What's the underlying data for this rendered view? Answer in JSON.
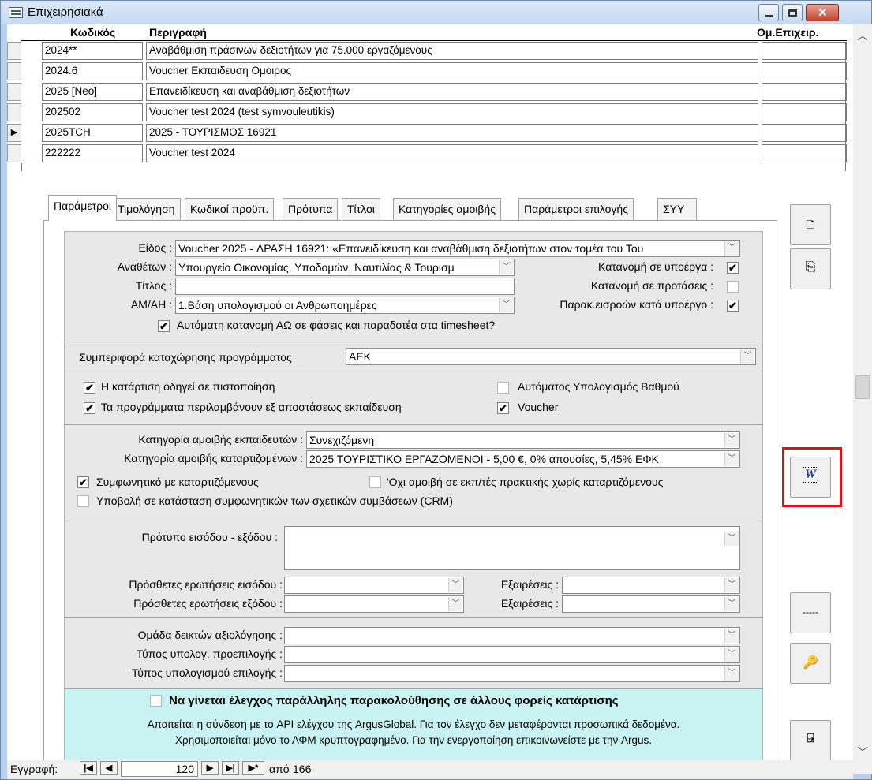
{
  "window": {
    "title": "Επιχειρησιακά"
  },
  "grid": {
    "headers": {
      "code": "Κωδικός",
      "description": "Περιγραφή",
      "group": "Ομ.Επιχειρ."
    },
    "rows": [
      {
        "code": "2024**",
        "description": "Αναβάθμιση πράσινων δεξιοτήτων για 75.000 εργαζόμενους",
        "group": ""
      },
      {
        "code": "2024.6",
        "description": "Voucher Εκπαιδευση Ομοιρος",
        "group": ""
      },
      {
        "code": "2025 [Neo]",
        "description": "Επανειδίκευση και αναβάθμιση δεξιοτήτων",
        "group": ""
      },
      {
        "code": "202502",
        "description": "Voucher test 2024 (test symvouleutikis)",
        "group": ""
      },
      {
        "code": "2025TCH",
        "description": "2025 - ΤΟΥΡΙΣΜΟΣ 16921",
        "group": ""
      },
      {
        "code": "222222",
        "description": "Voucher test 2024",
        "group": ""
      }
    ],
    "current_row_marker": "▶"
  },
  "tabs": [
    "Παράμετροι",
    "Τιμολόγηση",
    "Κωδικοί προϋπ.",
    "Πρότυπα",
    "Τίτλοι",
    "Κατηγορίες αμοιβής",
    "Παράμετροι επιλογής",
    "ΣΥΥ"
  ],
  "params": {
    "eidos_label": "Είδος :",
    "eidos_value": "Voucher 2025 - ΔΡΑΣΗ 16921: «Επανειδίκευση και αναβάθμιση δεξιοτήτων στον τομέα του Του",
    "anatheton_label": "Αναθέτων :",
    "anatheton_value": "Υπουργείο Οικονομίας, Υποδομών, Ναυτιλίας & Τουρισμ",
    "titlos_label": "Τίτλος :",
    "titlos_value": "",
    "amah_label": "ΑΜ/ΑΗ :",
    "amah_value": "1.Βάση υπολογισμού οι Ανθρωποημέρες",
    "katanomi_ypoerga_label": "Κατανομή σε υποέργα :",
    "katanomi_protaseis_label": "Κατανομή σε προτάσεις :",
    "parak_label": "Παρακ.εισροών κατά υποέργο :",
    "auto_katanomi_label": "Αυτόματη κατανομή ΑΩ σε φάσεις και παραδοτέα στα timesheet?",
    "symperifora_label": "Συμπεριφορά καταχώρησης προγράμματος",
    "symperifora_value": "ΑΕΚ",
    "katartisi_label": "Η κατάρτιση οδηγεί σε πιστοποίηση",
    "ex_apostaseos_label": "Τα προγράμματα περιλαμβάνουν εξ αποστάσεως εκπαίδευση",
    "auto_vathmos_label": "Αυτόματος Υπολογισμός Βαθμού",
    "voucher_label": "Voucher",
    "amoivi_ekp_label": "Κατηγορία αμοιβής εκπαιδευτών :",
    "amoivi_ekp_value": "Συνεχιζόμενη",
    "amoivi_kat_label": "Κατηγορία αμοιβής καταρτιζομένων :",
    "amoivi_kat_value": "2025 ΤΟΥΡΙΣΤΙΚΟ ΕΡΓΑΖΟΜΕΝΟΙ - 5,00 €, 0% απουσίες, 5,45% ΕΦΚ",
    "symfonitiko_label": "Συμφωνητικό με καταρτιζόμενους",
    "oxi_amoivi_label": "'Οχι αμοιβή σε εκπ/τές πρακτικής χωρίς καταρτιζόμενους",
    "ypovoli_label": "Υποβολή σε κατάσταση συμφωνητικών των σχετικών συμβάσεων (CRM)",
    "protypo_label": "Πρότυπο εισόδου - εξόδου :",
    "erot_eisodou_label": "Πρόσθετες ερωτήσεις εισόδου :",
    "erot_exodou_label": "Πρόσθετες ερωτήσεις εξόδου :",
    "exaireseis_label": "Εξαιρέσεις :",
    "omada_label": "Ομάδα δεικτών αξιολόγησης :",
    "typos_proepil_label": "Τύπος υπολογ. προεπιλογής :",
    "typos_epil_label": "Τύπος υπολογισμού επιλογής :",
    "info_title": "Να γίνεται έλεγχος παράλληλης παρακολούθησης σε άλλους φορείς κατάρτισης",
    "info_line1": "Απαιτείται η σύνδεση με το API ελέγχου της ArgusGlobal. Για τον έλεγχο δεν μεταφέρονται προσωπικά δεδομένα.",
    "info_line2": "Χρησιμοποιείται μόνο το ΑΦΜ κρυπτογραφημένο. Για την ενεργοποίηση επικοινωνείστε με την Argus."
  },
  "checks": {
    "katanomi_ypoerga": true,
    "katanomi_protaseis": false,
    "parak": true,
    "auto_katanomi": true,
    "katartisi": true,
    "ex_apostaseos": true,
    "auto_vathmos": false,
    "voucher": true,
    "symfonitiko": true,
    "oxi_amoivi": false,
    "ypovoli": false,
    "info": false
  },
  "sidebuttons": {
    "dash_label": "-----"
  },
  "nav": {
    "label": "Εγγραφή:",
    "current": "120",
    "of_label": "από",
    "total": "166"
  },
  "colors": {
    "highlight": "#e01010",
    "info_bg": "#c9f3f3"
  }
}
